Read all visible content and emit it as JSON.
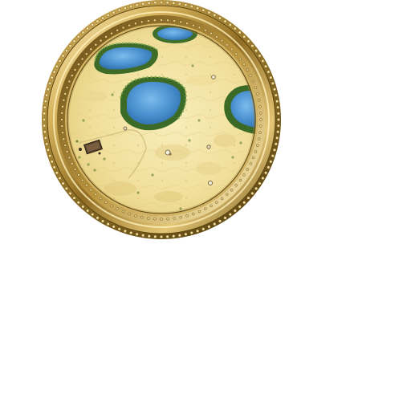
{
  "minimap": {
    "colors": {
      "sand": "#f2e3a2",
      "sand_dark": "#e5cf82",
      "sand_light": "#f8eebb",
      "water": "#3f87c8",
      "water_light": "#6fb3e6",
      "shore": "#b9c38a",
      "foliage": "#3d6d2a",
      "foliage_light": "#7ea84a",
      "frame_gold": "#c9a34a",
      "frame_dark": "#6e5418",
      "frame_light": "#f6e7a8",
      "building": "#4a3a28",
      "path": "#d8c78a"
    },
    "features": {
      "lakes": [
        "lake-north",
        "lake-northwest",
        "lake-center",
        "lake-east"
      ],
      "structures": [
        "settlement-building"
      ],
      "units": [
        "unit-marker-1",
        "unit-marker-2",
        "unit-marker-3",
        "unit-marker-4",
        "unit-marker-5"
      ]
    },
    "frame_style": "ornate gold round frame with beaded rim"
  }
}
